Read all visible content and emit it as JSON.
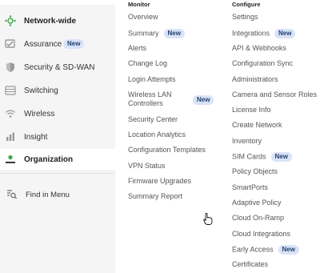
{
  "sidebar": {
    "items": [
      {
        "key": "network",
        "label": "Network-wide",
        "icon": "network-icon",
        "bold": true,
        "active": false
      },
      {
        "key": "assurance",
        "label": "Assurance",
        "icon": "assurance-icon",
        "badge": "New",
        "bold": false,
        "active": false
      },
      {
        "key": "security",
        "label": "Security & SD-WAN",
        "icon": "shield-icon",
        "bold": false,
        "active": false
      },
      {
        "key": "switching",
        "label": "Switching",
        "icon": "switch-icon",
        "bold": false,
        "active": false
      },
      {
        "key": "wireless",
        "label": "Wireless",
        "icon": "wifi-icon",
        "bold": false,
        "active": false
      },
      {
        "key": "insight",
        "label": "Insight",
        "icon": "insight-icon",
        "bold": false,
        "active": false
      },
      {
        "key": "organization",
        "label": "Organization",
        "icon": "organization-icon",
        "bold": true,
        "active": true
      }
    ],
    "find_label": "Find in Menu"
  },
  "menu": {
    "monitor": {
      "heading": "Monitor",
      "items": [
        {
          "label": "Overview"
        },
        {
          "label": "Summary",
          "badge": "New"
        },
        {
          "label": "Alerts"
        },
        {
          "label": "Change Log"
        },
        {
          "label": "Login Attempts"
        },
        {
          "label": "Wireless LAN Controllers",
          "badge": "New"
        },
        {
          "label": "Security Center"
        },
        {
          "label": "Location Analytics"
        },
        {
          "label": "Configuration Templates"
        },
        {
          "label": "VPN Status"
        },
        {
          "label": "Firmware Upgrades"
        },
        {
          "label": "Summary Report"
        }
      ]
    },
    "configure": {
      "heading": "Configure",
      "items": [
        {
          "label": "Settings"
        },
        {
          "label": "Integrations",
          "badge": "New"
        },
        {
          "label": "API & Webhooks"
        },
        {
          "label": "Configuration Sync"
        },
        {
          "label": "Administrators"
        },
        {
          "label": "Camera and Sensor Roles"
        },
        {
          "label": "License Info"
        },
        {
          "label": "Create Network"
        },
        {
          "label": "Inventory"
        },
        {
          "label": "SIM Cards",
          "badge": "New"
        },
        {
          "label": "Policy Objects"
        },
        {
          "label": "SmartPorts"
        },
        {
          "label": "Adaptive Policy"
        },
        {
          "label": "Cloud On-Ramp"
        },
        {
          "label": "Cloud Integrations"
        },
        {
          "label": "Early Access",
          "badge": "New"
        },
        {
          "label": "Certificates"
        }
      ]
    }
  },
  "colors": {
    "accent_green": "#3fa84a",
    "badge_bg": "#d9e3f8",
    "sidebar_bg": "#f5f5f6"
  }
}
